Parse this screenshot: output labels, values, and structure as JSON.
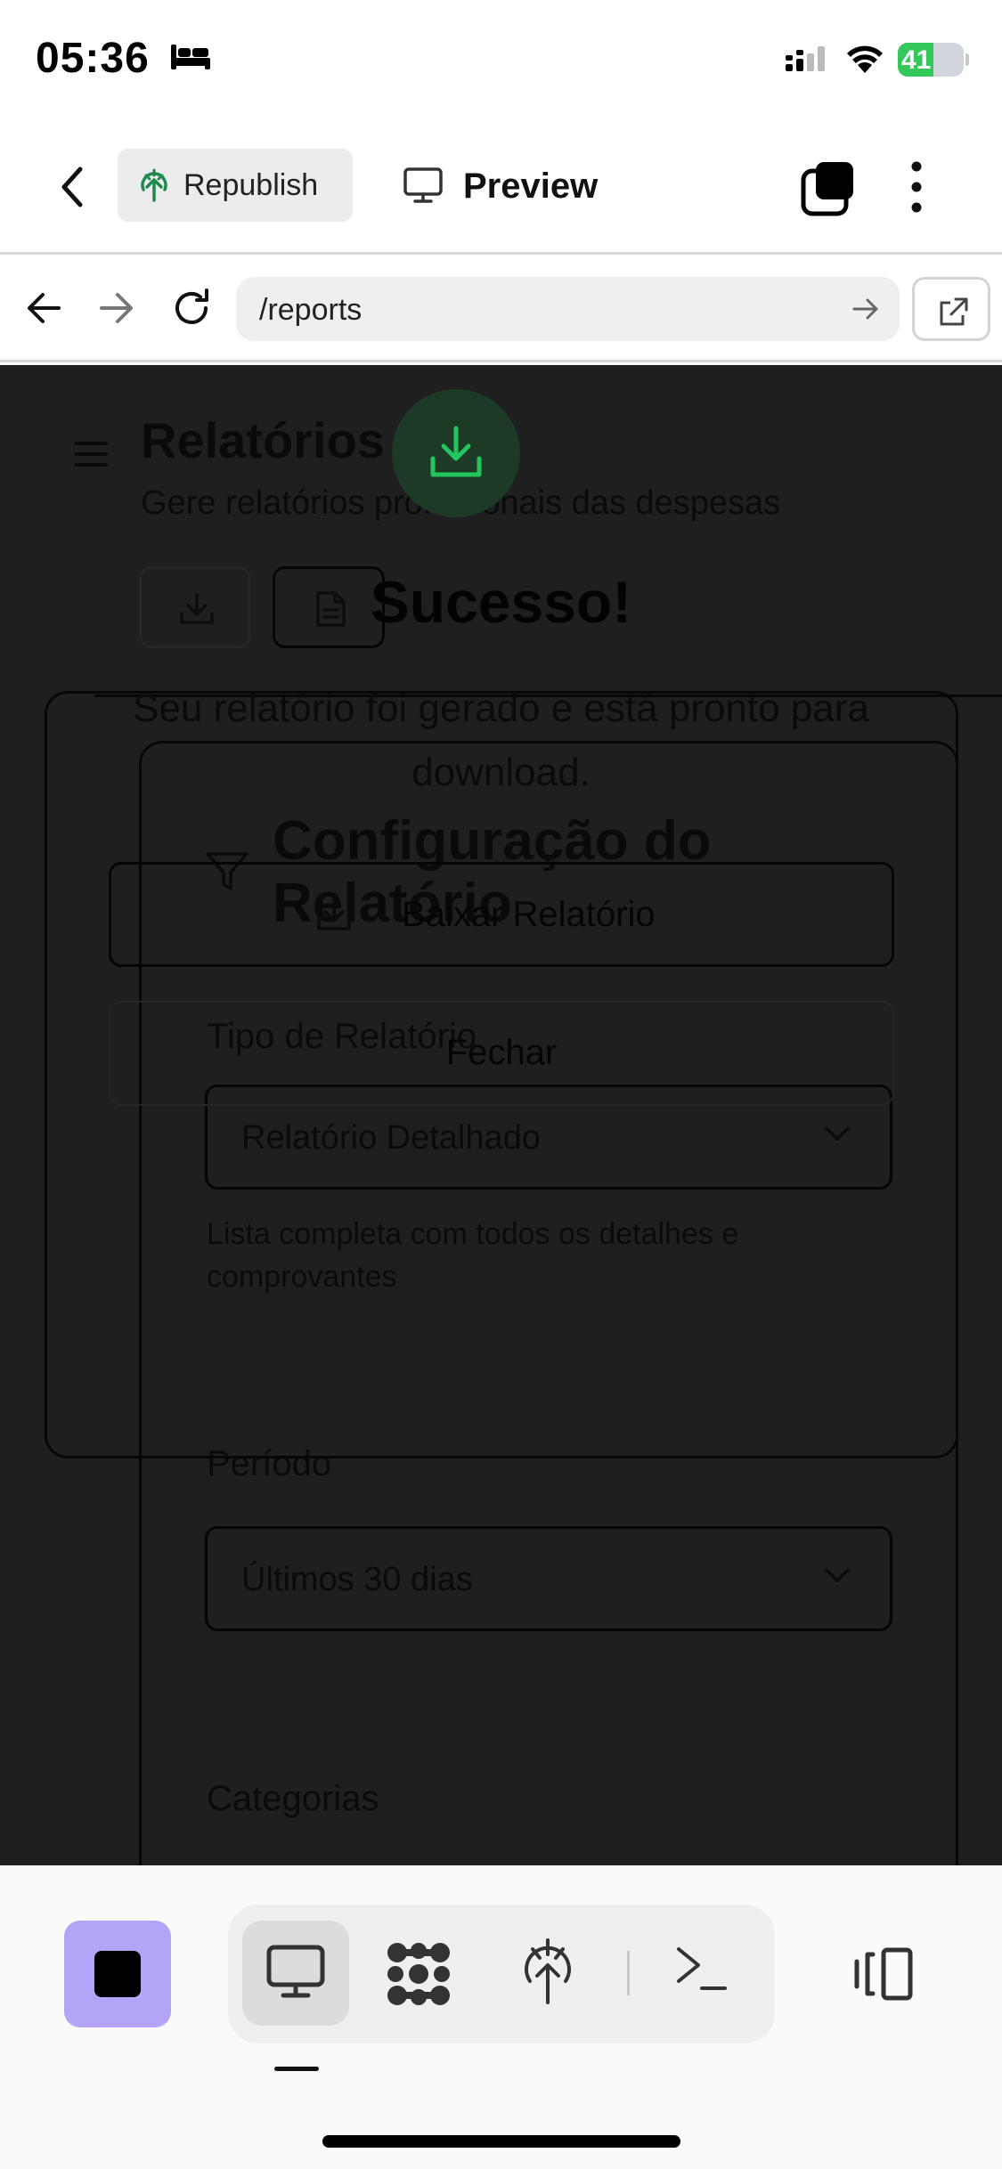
{
  "status_bar": {
    "time": "05:36",
    "battery": "41"
  },
  "header": {
    "republish_label": "Republish",
    "preview_label": "Preview"
  },
  "urlbar": {
    "url": "/reports"
  },
  "page": {
    "title": "Relatórios",
    "subtitle": "Gere relatórios profissionais das despesas",
    "config": {
      "title": "Configuração do Relatório",
      "type_label": "Tipo de Relatório",
      "type_value": "Relatório Detalhado",
      "type_description": "Lista completa com todos os detalhes e comprovantes",
      "period_label": "Período",
      "period_value": "Últimos 30 dias",
      "categories_label": "Categorias"
    }
  },
  "dialog": {
    "title": "Sucesso!",
    "message": "Seu relatório foi gerado e está pronto para download.",
    "download_label": "Baixar Relatório",
    "close_label": "Fechar"
  },
  "colors": {
    "accent_purple": "#b4a4f7",
    "success_green": "#22c55e",
    "battery_green": "#34c759"
  },
  "icons": [
    "bed-icon",
    "signal-icon",
    "wifi-icon",
    "back-icon",
    "republish-icon",
    "monitor-icon",
    "tabs-icon",
    "more-icon",
    "arrow-left-icon",
    "arrow-right-icon",
    "reload-icon",
    "open-external-icon",
    "menu-icon",
    "download-icon",
    "file-text-icon",
    "filter-icon",
    "chevron-down-icon",
    "stop-icon",
    "tools-icon",
    "deploy-icon",
    "shell-icon",
    "layout-icon"
  ]
}
